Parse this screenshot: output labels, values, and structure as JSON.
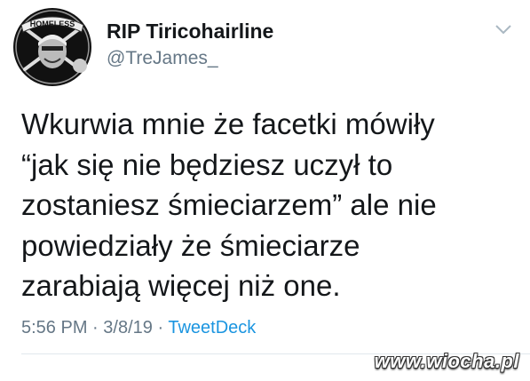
{
  "author": {
    "display_name": "RIP Tiricohairline",
    "handle": "@TreJames_",
    "avatar_icon": "raiders-homeless-logo-icon",
    "avatar_text": "HOMELESS"
  },
  "tweet": {
    "lines": [
      "Wkurwia mnie że facetki mówiły",
      "“jak się nie będziesz uczył to",
      "zostaniesz śmieciarzem” ale nie",
      "powiedziały że śmieciarze",
      "zarabiają więcej niż one."
    ],
    "time": "5:56 PM",
    "date": "3/8/19",
    "separator": "·",
    "source": "TweetDeck"
  },
  "menu_icon": "chevron-down-icon",
  "watermark": "www.wiocha.pl",
  "colors": {
    "text": "#14171a",
    "secondary": "#657786",
    "link": "#1b95e0",
    "divider": "#e1e8ed"
  }
}
